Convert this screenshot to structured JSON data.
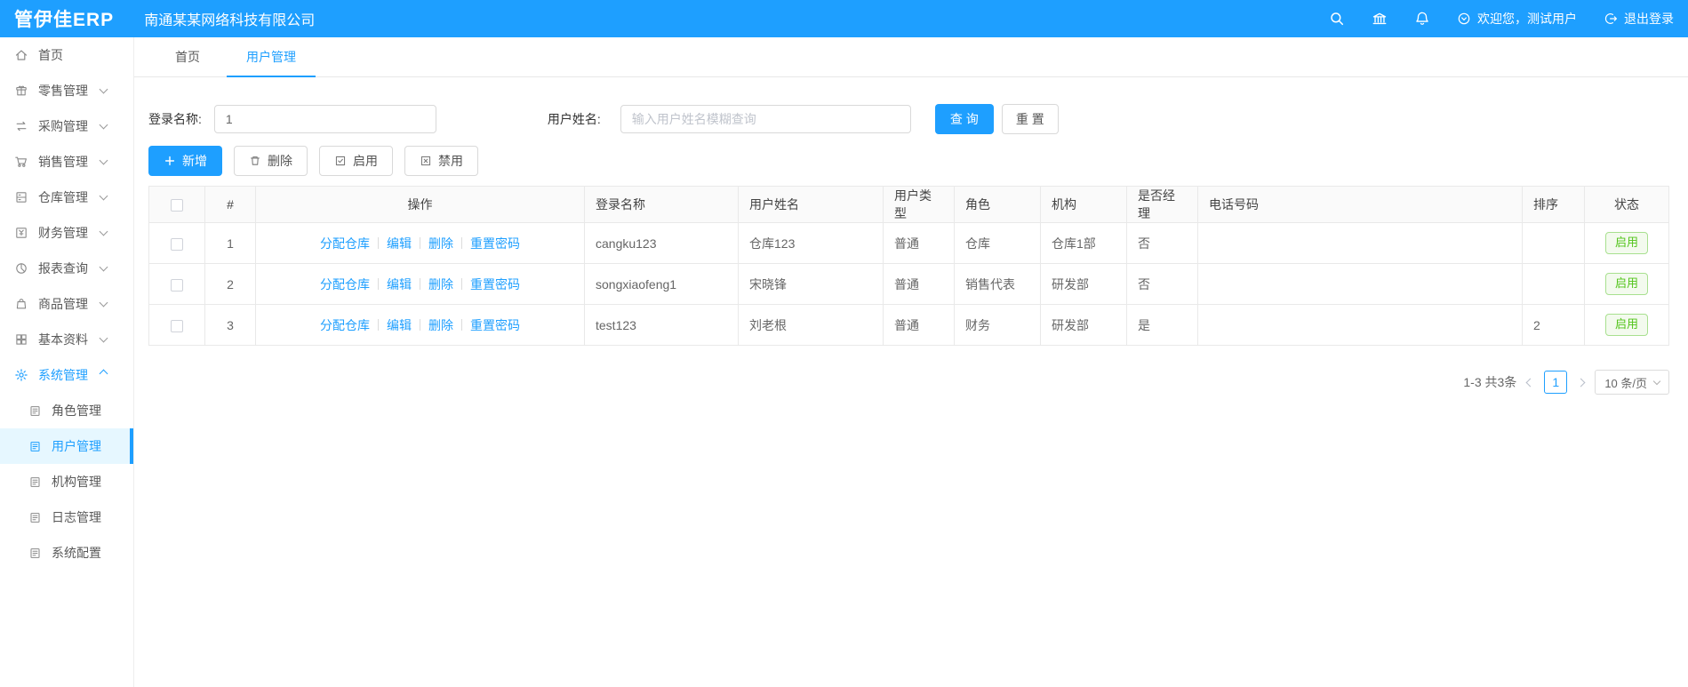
{
  "header": {
    "logo": "管伊佳ERP",
    "company": "南通某某网络科技有限公司",
    "welcome": "欢迎您，测试用户",
    "logout": "退出登录"
  },
  "sidebar": {
    "items": [
      {
        "label": "首页",
        "icon": "home-icon"
      },
      {
        "label": "零售管理",
        "icon": "retail-icon"
      },
      {
        "label": "采购管理",
        "icon": "purchase-icon"
      },
      {
        "label": "销售管理",
        "icon": "cart-icon"
      },
      {
        "label": "仓库管理",
        "icon": "warehouse-icon"
      },
      {
        "label": "财务管理",
        "icon": "finance-icon"
      },
      {
        "label": "报表查询",
        "icon": "report-icon"
      },
      {
        "label": "商品管理",
        "icon": "goods-icon"
      },
      {
        "label": "基本资料",
        "icon": "grid-icon"
      },
      {
        "label": "系统管理",
        "icon": "gear-icon",
        "active": true
      }
    ],
    "subitems": [
      {
        "label": "角色管理"
      },
      {
        "label": "用户管理",
        "active": true
      },
      {
        "label": "机构管理"
      },
      {
        "label": "日志管理"
      },
      {
        "label": "系统配置"
      }
    ]
  },
  "tabs": [
    {
      "label": "首页"
    },
    {
      "label": "用户管理",
      "active": true
    }
  ],
  "search": {
    "login_label": "登录名称:",
    "login_value": "1",
    "name_label": "用户姓名:",
    "name_placeholder": "输入用户姓名模糊查询",
    "query_button": "查 询",
    "reset_button": "重 置"
  },
  "toolbar": {
    "add": "新增",
    "delete": "删除",
    "enable": "启用",
    "disable": "禁用"
  },
  "table": {
    "headers": {
      "index": "#",
      "action": "操作",
      "login": "登录名称",
      "name": "用户姓名",
      "type": "用户类型",
      "role": "角色",
      "org": "机构",
      "manager": "是否经理",
      "phone": "电话号码",
      "sort": "排序",
      "status": "状态"
    },
    "action_links": [
      "分配仓库",
      "编辑",
      "删除",
      "重置密码"
    ],
    "rows": [
      {
        "index": "1",
        "login": "cangku123",
        "name": "仓库123",
        "type": "普通",
        "role": "仓库",
        "org": "仓库1部",
        "manager": "否",
        "phone": "",
        "sort": "",
        "status": "启用"
      },
      {
        "index": "2",
        "login": "songxiaofeng1",
        "name": "宋晓锋",
        "type": "普通",
        "role": "销售代表",
        "org": "研发部",
        "manager": "否",
        "phone": "",
        "sort": "",
        "status": "启用"
      },
      {
        "index": "3",
        "login": "test123",
        "name": "刘老根",
        "type": "普通",
        "role": "财务",
        "org": "研发部",
        "manager": "是",
        "phone": "",
        "sort": "2",
        "status": "启用"
      }
    ]
  },
  "pagination": {
    "total": "1-3 共3条",
    "current_page": "1",
    "page_size": "10 条/页"
  },
  "colors": {
    "primary": "#1E9FFF",
    "status_green": "#52c41a",
    "active_menu_bg": "#e6f7ff"
  }
}
